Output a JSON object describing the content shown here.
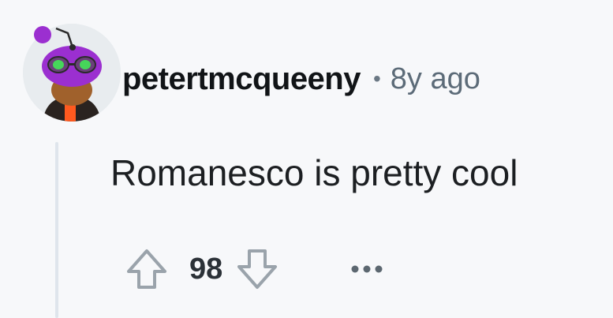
{
  "comment": {
    "author": "petertmcqueeny",
    "separator": "•",
    "age": "8y ago",
    "body": "Romanesco is pretty cool",
    "score": "98"
  },
  "icons": {
    "upvote": "upvote-arrow-icon",
    "downvote": "downvote-arrow-icon",
    "more": "more-options-icon"
  },
  "colors": {
    "background": "#f7f8fa",
    "thread_line": "#dfe5ec",
    "avatar_accent": "#9b2fd0",
    "icon_gray": "#9aa3ab"
  }
}
